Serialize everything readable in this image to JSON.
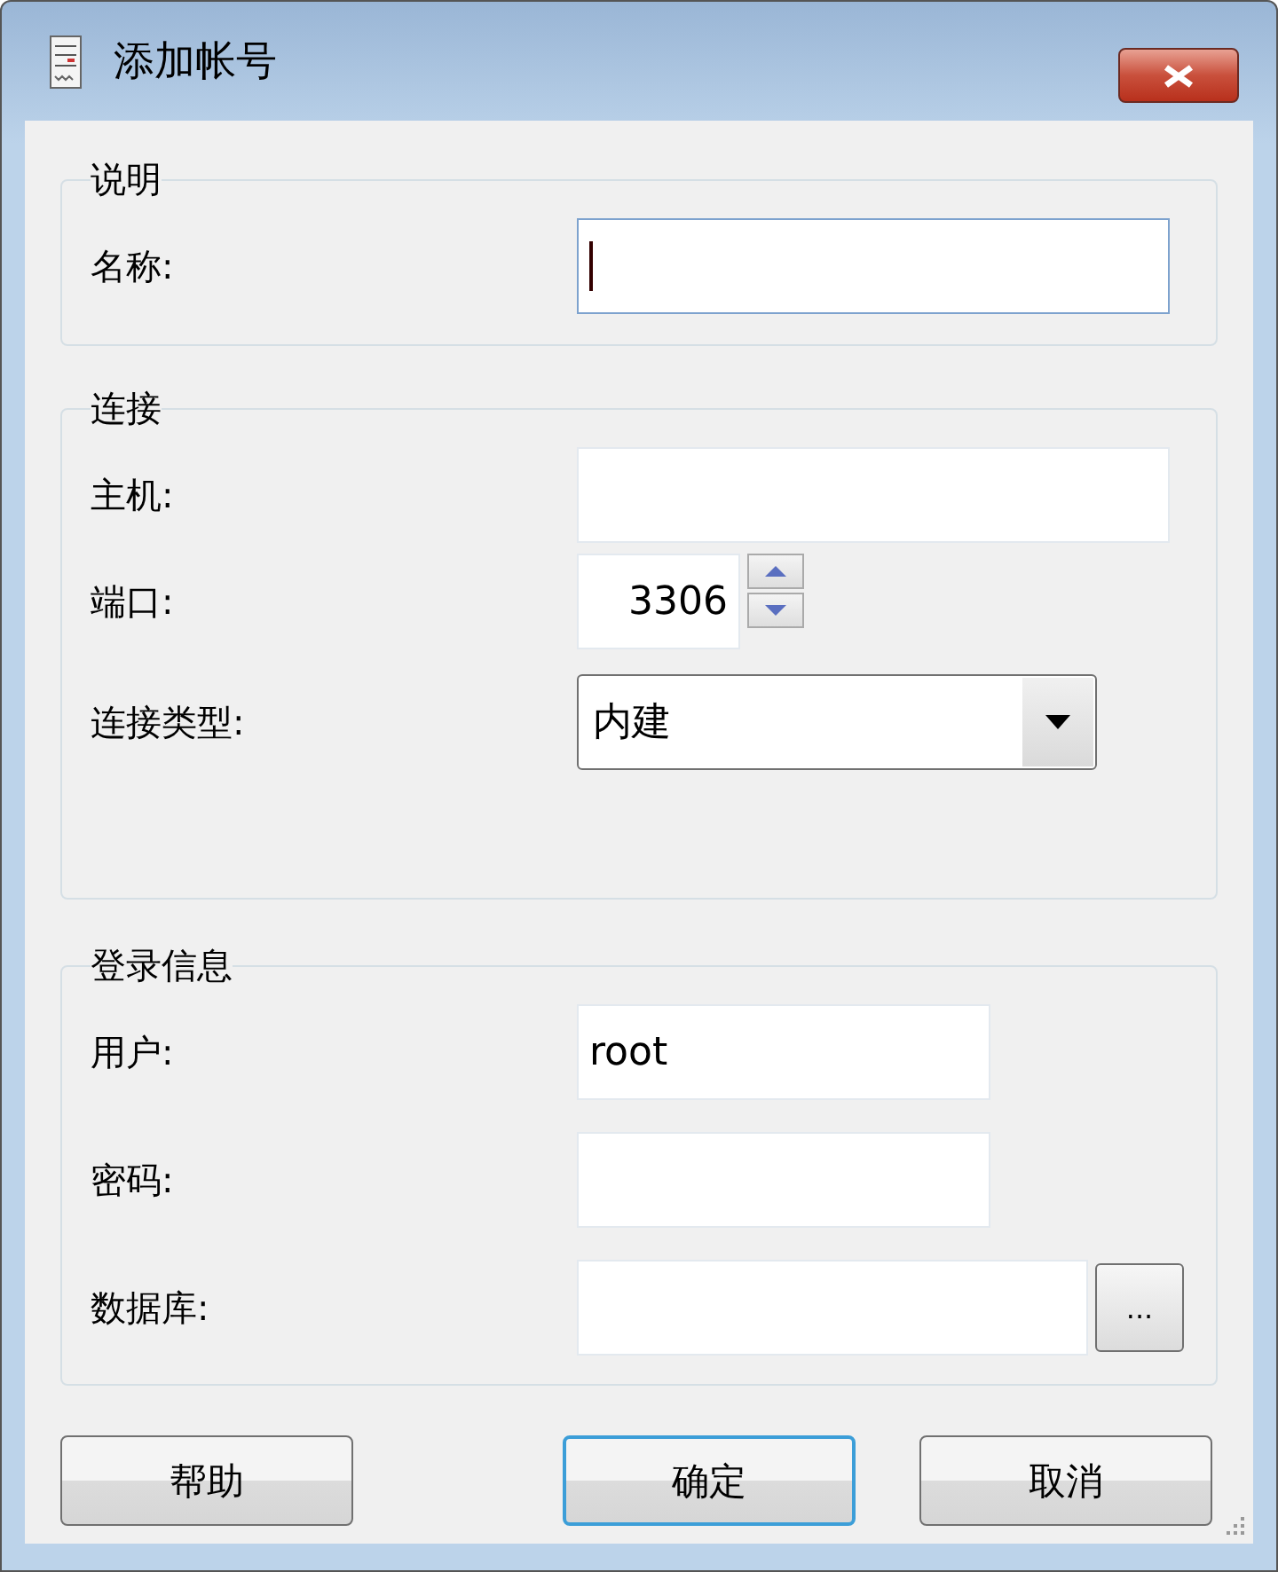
{
  "window": {
    "title": "添加帐号"
  },
  "groups": [
    {
      "title": "说明",
      "fields": [
        {
          "label": "名称:",
          "kind": "text",
          "focused": true
        }
      ]
    },
    {
      "title": "连接",
      "fields": [
        {
          "label": "主机:",
          "kind": "text",
          "focused": false
        },
        {
          "label": "端口:",
          "kind": "spin",
          "value": "3306",
          "focused": false
        },
        {
          "label": "连接类型:",
          "kind": "combo",
          "value": "内建",
          "focused": false
        }
      ]
    },
    {
      "title": "登录信息",
      "fields": [
        {
          "label": "用户:",
          "kind": "text",
          "value": "root",
          "focused": false
        },
        {
          "label": "密码:",
          "kind": "password",
          "focused": false
        },
        {
          "label": "数据库:",
          "kind": "browse",
          "focused": false,
          "button": "..."
        }
      ]
    }
  ],
  "buttons": [
    {
      "label": "帮助",
      "default": false
    },
    {
      "label": "确定",
      "default": true
    },
    {
      "label": "取消",
      "default": false
    }
  ]
}
